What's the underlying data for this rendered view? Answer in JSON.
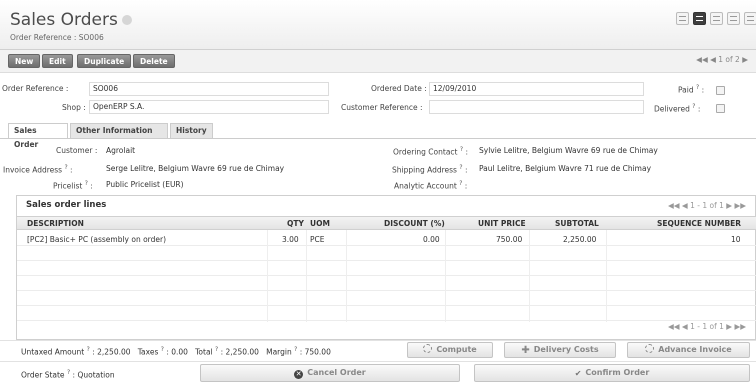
{
  "header": {
    "title": "Sales Orders",
    "subtitle": "Order Reference : SO006"
  },
  "toolbar": {
    "new_label": "New",
    "edit_label": "Edit",
    "duplicate_label": "Duplicate",
    "delete_label": "Delete",
    "pager": "1 of 2"
  },
  "form": {
    "order_reference_label": "Order Reference :",
    "order_reference": "SO006",
    "shop_label": "Shop :",
    "shop": "OpenERP S.A.",
    "ordered_date_label": "Ordered Date :",
    "ordered_date": "12/09/2010",
    "customer_reference_label": "Customer Reference :",
    "customer_reference": "",
    "paid_label": "Paid",
    "delivered_label": "Delivered",
    "help_mark": "?",
    "colon": ":"
  },
  "tabs": [
    "Sales Order",
    "Other Information",
    "History"
  ],
  "sales_order": {
    "customer_label": "Customer :",
    "customer": "Agrolait",
    "invoice_address_label": "Invoice Address",
    "invoice_address": "Serge Lelitre, Belgium Wavre 69 rue de Chimay",
    "pricelist_label": "Pricelist",
    "pricelist": "Public Pricelist (EUR)",
    "ordering_contact_label": "Ordering Contact",
    "ordering_contact": "Sylvie Lelitre, Belgium Wavre 69 rue de Chimay",
    "shipping_address_label": "Shipping Address",
    "shipping_address": "Paul Lelitre, Belgium Wavre 71 rue de Chimay",
    "analytic_account_label": "Analytic Account",
    "analytic_account": ""
  },
  "lines": {
    "title": "Sales order lines",
    "pager": "1 - 1 of 1",
    "columns": [
      "DESCRIPTION",
      "QTY",
      "UOM",
      "DISCOUNT (%)",
      "UNIT PRICE",
      "SUBTOTAL",
      "SEQUENCE NUMBER"
    ],
    "rows": [
      {
        "description": "[PC2] Basic+ PC (assembly on order)",
        "qty": "3.00",
        "uom": "PCE",
        "discount": "0.00",
        "unit_price": "750.00",
        "subtotal": "2,250.00",
        "sequence": "10"
      }
    ]
  },
  "totals": {
    "untaxed_label": "Untaxed Amount",
    "untaxed": "2,250.00",
    "taxes_label": "Taxes",
    "taxes": "0.00",
    "total_label": "Total",
    "total": "2,250.00",
    "margin_label": "Margin",
    "margin": "750.00"
  },
  "actions": {
    "compute": "Compute",
    "delivery_costs": "Delivery Costs",
    "advance_invoice": "Advance Invoice",
    "cancel_order": "Cancel Order",
    "confirm_order": "Confirm Order"
  },
  "state": {
    "label": "Order State",
    "value": "Quotation"
  }
}
